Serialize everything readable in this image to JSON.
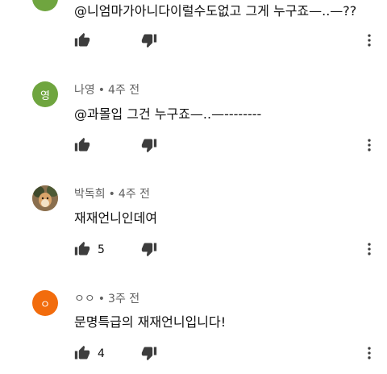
{
  "colors": {
    "avatar_green": "#6fa53f",
    "avatar_orange": "#f26c0d",
    "meta_text": "#606060",
    "icon": "#3d3d3d"
  },
  "icons": {
    "like": "thumb-up-icon",
    "dislike": "thumb-down-icon",
    "more": "more-vert-icon"
  },
  "comments": [
    {
      "author": "",
      "time": "",
      "text": "@니엄마가아니다이럴수도없고 그게 누구죠—..—??",
      "likes": ""
    },
    {
      "avatar_letter": "영",
      "author": "나영",
      "time": "4주 전",
      "text": "@과몰입 그건 누구죠—..—--------",
      "likes": ""
    },
    {
      "avatar_letter": "",
      "author": "박독희",
      "time": "4주 전",
      "text": "재재언니인데여",
      "likes": "5"
    },
    {
      "avatar_letter": "ㅇ",
      "author": "ㅇㅇ",
      "time": "3주 전",
      "text": "문명특급의 재재언니입니다!",
      "likes": "4"
    }
  ]
}
